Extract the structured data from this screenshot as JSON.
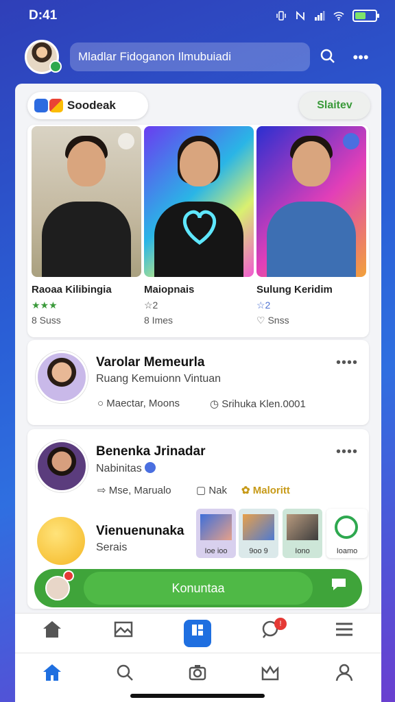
{
  "status_bar": {
    "time": "D:41",
    "battery_level": 0.55,
    "icons": [
      "vibrate-icon",
      "nfc-icon",
      "signal-icon",
      "wifi-icon",
      "battery-icon"
    ]
  },
  "top_bar": {
    "search_text": "Mladlar Fidoganon Ilmubuiadi",
    "icons": [
      "profile-avatar",
      "search-icon",
      "more-icon"
    ]
  },
  "chips": {
    "left_label": "Soodeak",
    "right_label": "Slaitev"
  },
  "stories": [
    {
      "name": "Raoaa Kilibingia",
      "stars": "★★★",
      "count": "8 Suss"
    },
    {
      "name": "Maiopnais",
      "stars": "☆2",
      "count": "8 Imes"
    },
    {
      "name": "Sulung Keridim",
      "stars": "☆2",
      "count": "♡ Snss"
    }
  ],
  "cards": [
    {
      "title": "Varolar Memeurla",
      "subtitle": "Ruang Kemuionn Vintuan",
      "meta_left": "Maectar,  Moons",
      "meta_right": "Srihuka Klen.0001"
    },
    {
      "title": "Benenka Jrinadar",
      "subtitle": "Nabinitas",
      "meta_left": "Mse,  Marualo",
      "meta_mid": "Nak",
      "meta_right": "Maloritt"
    },
    {
      "title": "Vienuenunaka",
      "subtitle": "Serais"
    }
  ],
  "thumbnails": [
    {
      "label": "Ioe ioo"
    },
    {
      "label": "9oo 9"
    },
    {
      "label": "Iono"
    },
    {
      "label": "Ioamo"
    }
  ],
  "cta": {
    "label": "Konuntaa"
  },
  "colors": {
    "accent": "#1f6fe0",
    "green": "#3fa43a",
    "badge": "#e53935"
  }
}
